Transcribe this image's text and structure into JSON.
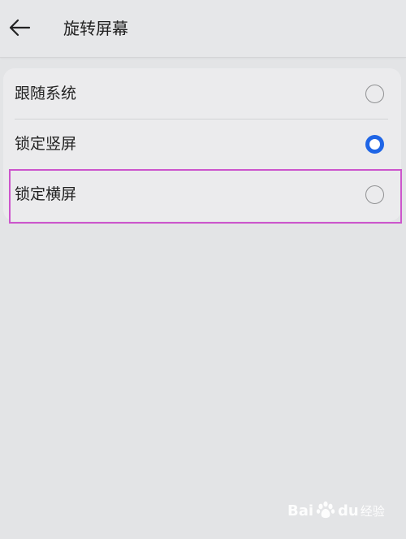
{
  "header": {
    "back_icon": "arrow-left-icon",
    "title": "旋转屏幕"
  },
  "options": [
    {
      "label": "跟随系统",
      "selected": false
    },
    {
      "label": "锁定竖屏",
      "selected": true
    },
    {
      "label": "锁定横屏",
      "selected": false
    }
  ],
  "highlight_target": "锁定横屏",
  "watermark": {
    "brand_a": "Bai",
    "brand_b": "du",
    "suffix": "经验",
    "icon": "baidu-paw-icon"
  },
  "colors": {
    "accent": "#1f65e6",
    "highlight": "#cc55cc"
  }
}
